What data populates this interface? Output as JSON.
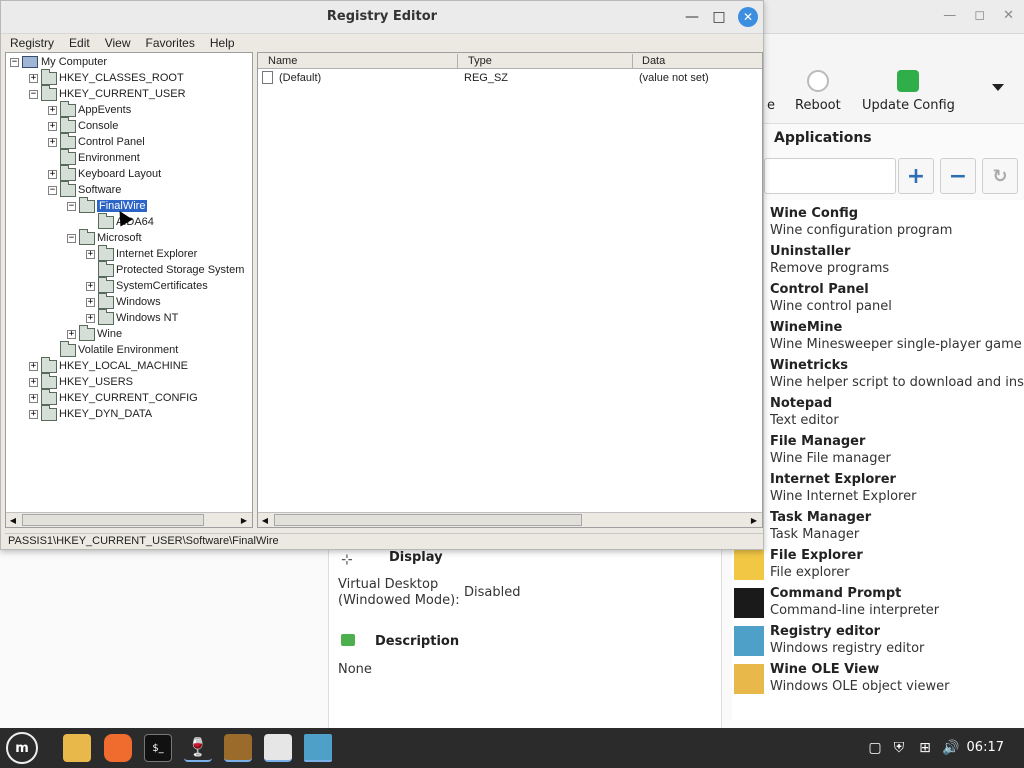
{
  "background_app": {
    "toolbar": [
      {
        "label": "e"
      },
      {
        "label": "Reboot"
      },
      {
        "label": "Update Config"
      }
    ],
    "applications_header": "Applications",
    "buttons": {
      "add": "+",
      "remove": "−",
      "refresh": "↻"
    },
    "apps": [
      {
        "title": "Wine Config",
        "desc": "Wine configuration program"
      },
      {
        "title": "Uninstaller",
        "desc": "Remove programs"
      },
      {
        "title": "Control Panel",
        "desc": "Wine control panel"
      },
      {
        "title": "WineMine",
        "desc": "Wine Minesweeper single-player game"
      },
      {
        "title": "Winetricks",
        "desc": "Wine helper script to download and insta"
      },
      {
        "title": "Notepad",
        "desc": "Text editor"
      },
      {
        "title": "File Manager",
        "desc": "Wine File manager"
      },
      {
        "title": "Internet Explorer",
        "desc": "Wine Internet Explorer"
      },
      {
        "title": "Task Manager",
        "desc": "Task Manager"
      },
      {
        "title": "File Explorer",
        "desc": "File explorer"
      },
      {
        "title": "Command Prompt",
        "desc": "Command-line interpreter"
      },
      {
        "title": "Registry editor",
        "desc": "Windows registry editor"
      },
      {
        "title": "Wine OLE View",
        "desc": "Windows OLE object viewer"
      }
    ],
    "details": {
      "display_header": "Display",
      "virtual_desktop_label_1": "Virtual Desktop",
      "virtual_desktop_label_2": "(Windowed Mode):",
      "virtual_desktop_value": "Disabled",
      "description_header": "Description",
      "description_value": "None"
    }
  },
  "registry_editor": {
    "title": "Registry Editor",
    "window_buttons": {
      "minimize": "—",
      "maximize": "□",
      "close": "✕"
    },
    "menu": [
      "Registry",
      "Edit",
      "View",
      "Favorites",
      "Help"
    ],
    "tree": [
      {
        "label": "My Computer",
        "expander": "−"
      },
      {
        "label": "HKEY_CLASSES_ROOT",
        "expander": "+"
      },
      {
        "label": "HKEY_CURRENT_USER",
        "expander": "−"
      },
      {
        "label": "AppEvents",
        "expander": "+"
      },
      {
        "label": "Console",
        "expander": "+"
      },
      {
        "label": "Control Panel",
        "expander": "+"
      },
      {
        "label": "Environment",
        "expander": ""
      },
      {
        "label": "Keyboard Layout",
        "expander": "+"
      },
      {
        "label": "Software",
        "expander": "−"
      },
      {
        "label": "FinalWire",
        "expander": "−",
        "selected": true
      },
      {
        "label": "AIDA64",
        "expander": ""
      },
      {
        "label": "Microsoft",
        "expander": "−"
      },
      {
        "label": "Internet Explorer",
        "expander": "+"
      },
      {
        "label": "Protected Storage System",
        "expander": ""
      },
      {
        "label": "SystemCertificates",
        "expander": "+"
      },
      {
        "label": "Windows",
        "expander": "+"
      },
      {
        "label": "Windows NT",
        "expander": "+"
      },
      {
        "label": "Wine",
        "expander": "+"
      },
      {
        "label": "Volatile Environment",
        "expander": ""
      },
      {
        "label": "HKEY_LOCAL_MACHINE",
        "expander": "+"
      },
      {
        "label": "HKEY_USERS",
        "expander": "+"
      },
      {
        "label": "HKEY_CURRENT_CONFIG",
        "expander": "+"
      },
      {
        "label": "HKEY_DYN_DATA",
        "expander": "+"
      }
    ],
    "list_columns": {
      "name": "Name",
      "type": "Type",
      "data": "Data"
    },
    "list_rows": [
      {
        "name": "(Default)",
        "type": "REG_SZ",
        "data": "(value not set)"
      }
    ],
    "status": "PASSIS1\\HKEY_CURRENT_USER\\Software\\FinalWire"
  },
  "taskbar": {
    "clock": "06:17"
  }
}
